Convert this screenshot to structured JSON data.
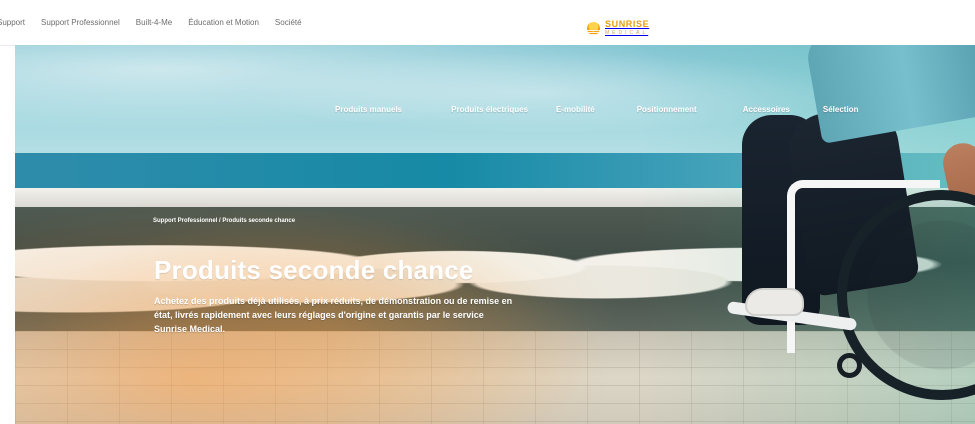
{
  "top_navigation": [
    "Support",
    "Support Professionnel",
    "Built-4-Me",
    "Éducation et Motion",
    "Société"
  ],
  "logo": {
    "name": "SUNRISE",
    "subtitle": "MEDICAL"
  },
  "hero_navigation": [
    "Produits manuels",
    "Produits électriques",
    "E-mobilité",
    "Positionnement",
    "Accessoires",
    "Sélection"
  ],
  "breadcrumb": "Support Professionnel / Produits seconde chance",
  "page_title": "Produits seconde chance",
  "description": "Achetez des produits déjà utilisés, à prix réduits, de démonstration ou de remise en état, livrés rapidement avec leurs réglages d'origine et garantis par le service Sunrise Medical."
}
